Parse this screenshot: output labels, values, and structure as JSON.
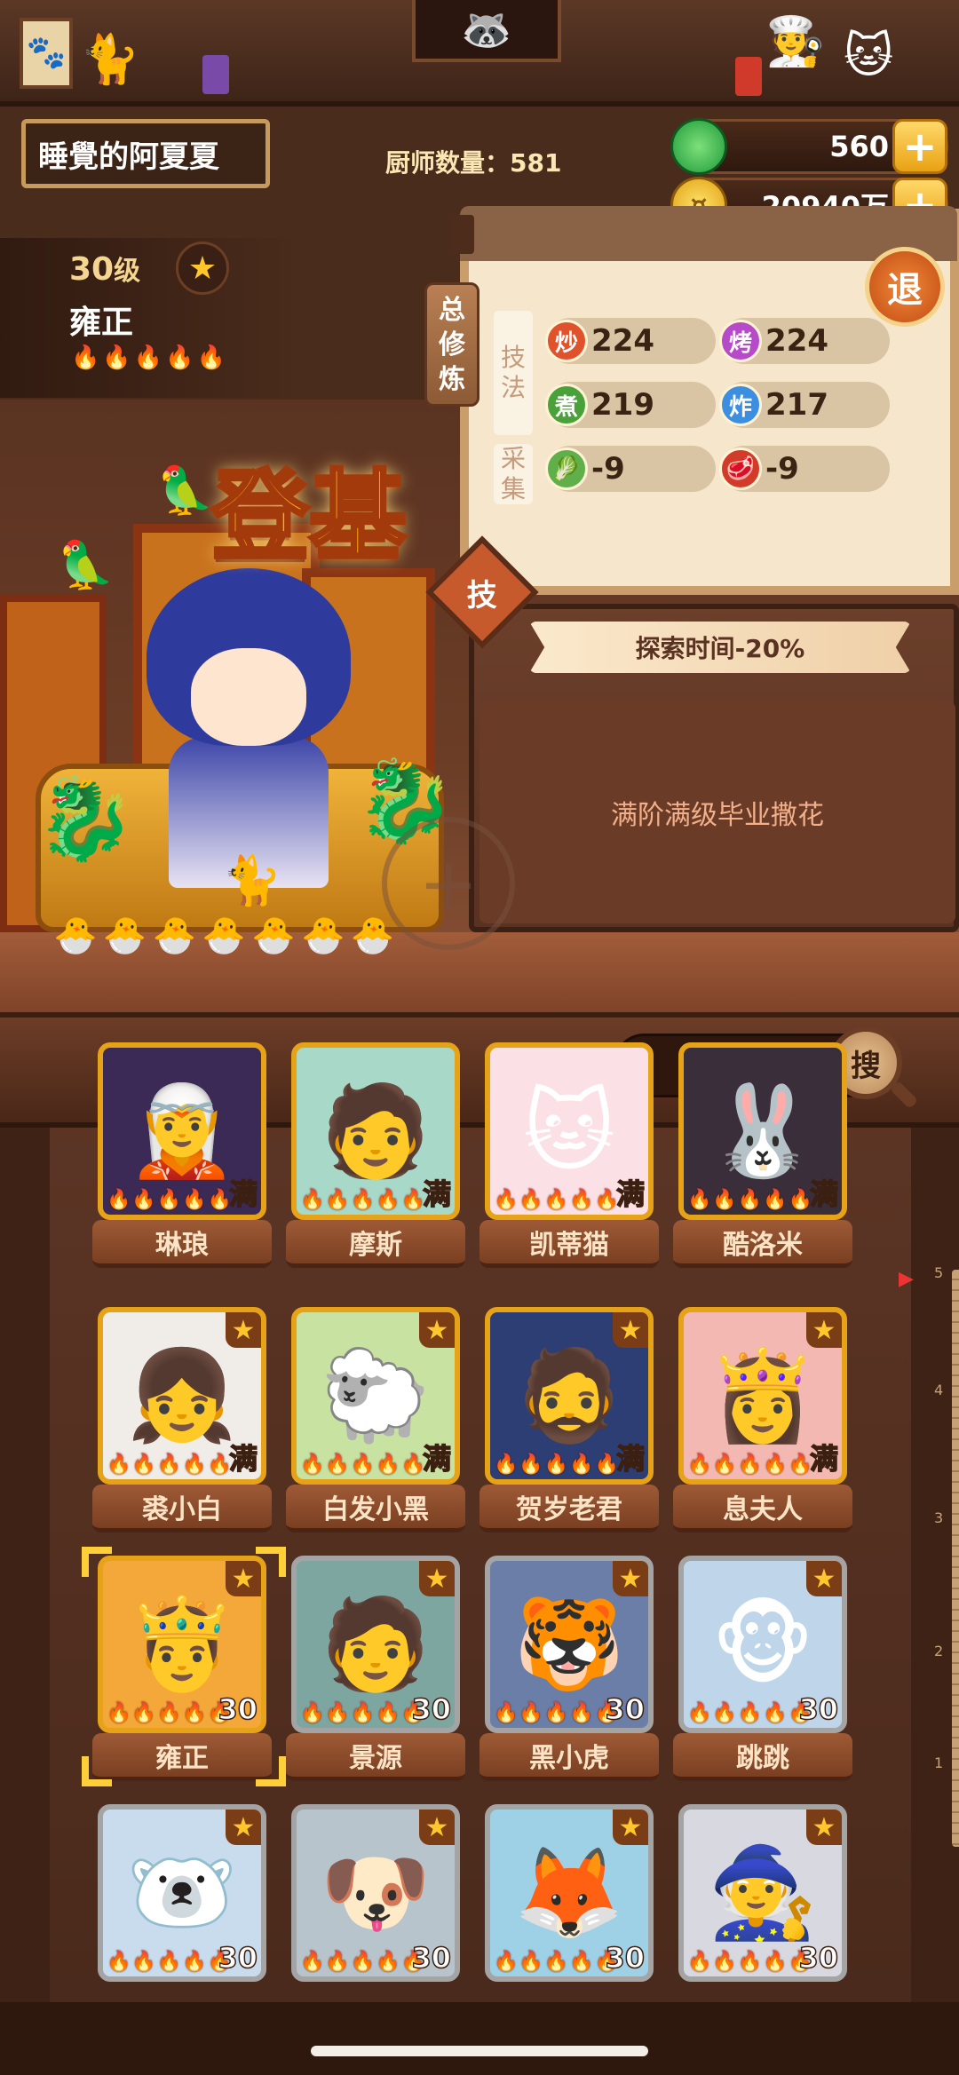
{
  "header": {
    "player_name": "睡覺的阿夏夏",
    "chef_count_label": "厨师数量：",
    "chef_count": "581",
    "jade": "560",
    "coins": "20940万"
  },
  "character": {
    "level": "30",
    "level_unit": "级",
    "name": "雍正",
    "flames": "🔥🔥🔥🔥🔥",
    "title": "登基"
  },
  "panel": {
    "total_train": [
      "总",
      "修",
      "炼"
    ],
    "exit_label": "退",
    "skill_section": [
      "技",
      "法"
    ],
    "gather_section": [
      "采",
      "集"
    ],
    "stats": [
      {
        "badge": "炒",
        "value": "224",
        "color": "#e0522b"
      },
      {
        "badge": "烤",
        "value": "224",
        "color": "#b64ac8"
      },
      {
        "badge": "煮",
        "value": "219",
        "color": "#4aa13a"
      },
      {
        "badge": "炸",
        "value": "217",
        "color": "#3c8ee0"
      },
      {
        "badge": "🥬",
        "value": "-9",
        "color": "#5fb04a"
      },
      {
        "badge": "🥩",
        "value": "-9",
        "color": "#d23a2a"
      }
    ],
    "skill_button": "技",
    "explore_effect": "探索时间-20%",
    "motto": "满阶满级毕业撒花"
  },
  "toolbar": {
    "icons": [
      "chicken-leg-icon",
      "shovel-icon",
      "jar-icon",
      "map-pin-icon",
      "map-icon"
    ],
    "search_label": "搜"
  },
  "roster": [
    {
      "name": "琳琅",
      "tag": "满",
      "art": "🧝",
      "bg": "#3b2a55",
      "star": false
    },
    {
      "name": "摩斯",
      "tag": "满",
      "art": "🧑",
      "bg": "#a8d8c8",
      "star": false
    },
    {
      "name": "凯蒂猫",
      "tag": "满",
      "art": "🐱",
      "bg": "#fbe0e6",
      "star": false
    },
    {
      "name": "酷洛米",
      "tag": "满",
      "art": "🐰",
      "bg": "#3a2e3a",
      "star": false
    },
    {
      "name": "裘小白",
      "tag": "满",
      "art": "👧",
      "bg": "#f0ece8",
      "star": true
    },
    {
      "name": "白发小黑",
      "tag": "满",
      "art": "🐑",
      "bg": "#c8e2a2",
      "star": true
    },
    {
      "name": "贺岁老君",
      "tag": "满",
      "art": "🧔",
      "bg": "#2c3e74",
      "star": true
    },
    {
      "name": "息夫人",
      "tag": "满",
      "art": "👸",
      "bg": "#f4b8b2",
      "star": true
    },
    {
      "name": "雍正",
      "tag": "30",
      "art": "🤴",
      "bg": "#f4a83a",
      "star": true,
      "selected": true
    },
    {
      "name": "景源",
      "tag": "30",
      "art": "🧑",
      "bg": "#7ea6a0",
      "star": true,
      "gray": true
    },
    {
      "name": "黑小虎",
      "tag": "30",
      "art": "🐯",
      "bg": "#6a7ea8",
      "star": true,
      "gray": true
    },
    {
      "name": "跳跳",
      "tag": "30",
      "art": "🐵",
      "bg": "#bfd6ea",
      "star": true,
      "gray": true
    },
    {
      "name": "",
      "tag": "30",
      "art": "🐻‍❄️",
      "bg": "#c8dcee",
      "star": true,
      "gray": true
    },
    {
      "name": "",
      "tag": "30",
      "art": "🐶",
      "bg": "#b8c4cc",
      "star": true,
      "gray": true
    },
    {
      "name": "",
      "tag": "30",
      "art": "🦊",
      "bg": "#9ed0e6",
      "star": true,
      "gray": true
    },
    {
      "name": "",
      "tag": "30",
      "art": "🧙",
      "bg": "#d8d8e0",
      "star": true,
      "gray": true
    }
  ],
  "scale_numbers": [
    "5",
    "4",
    "3",
    "2",
    "1"
  ]
}
